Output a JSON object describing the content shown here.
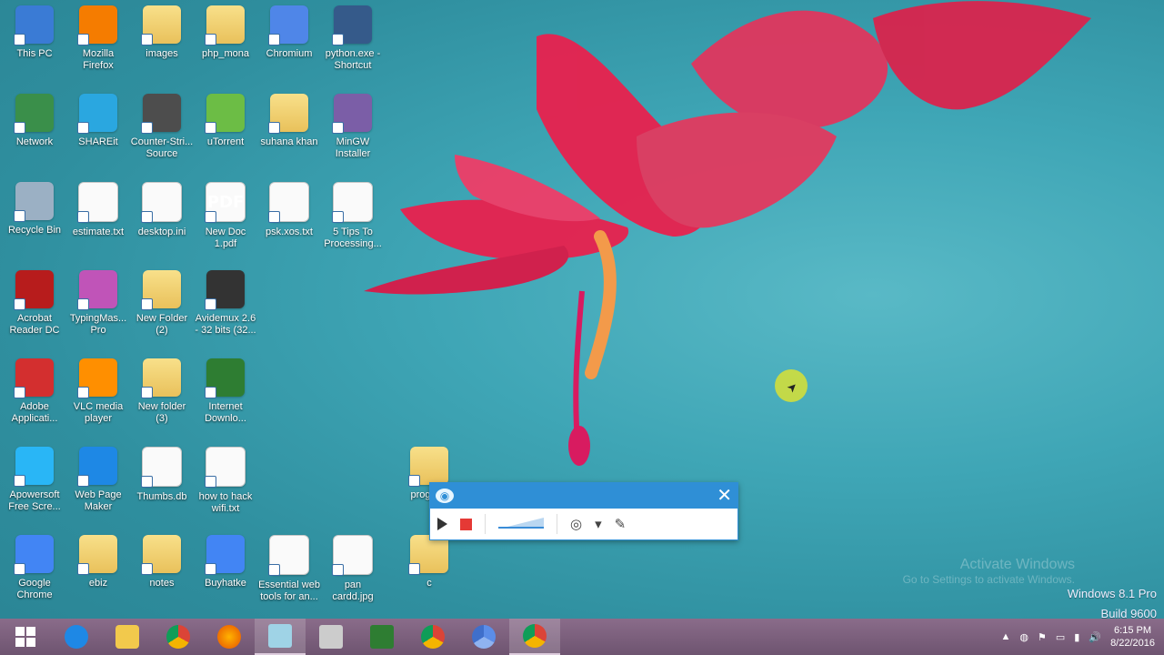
{
  "desktop_icons": [
    {
      "label": "This PC",
      "icon": "computer-icon"
    },
    {
      "label": "Mozilla\nFirefox",
      "icon": "firefox-icon"
    },
    {
      "label": "images",
      "icon": "folder-icon"
    },
    {
      "label": "php_mona",
      "icon": "folder-icon"
    },
    {
      "label": "Chromium",
      "icon": "chromium-icon"
    },
    {
      "label": "python.exe -\nShortcut",
      "icon": "python-icon"
    },
    {
      "label": "Network",
      "icon": "network-icon"
    },
    {
      "label": "SHAREit",
      "icon": "shareit-icon"
    },
    {
      "label": "Counter-Stri...\nSource",
      "icon": "counter-strike-icon"
    },
    {
      "label": "uTorrent",
      "icon": "utorrent-icon"
    },
    {
      "label": "suhana khan",
      "icon": "folder-icon"
    },
    {
      "label": "MinGW\nInstaller",
      "icon": "installer-icon"
    },
    {
      "label": "Recycle Bin",
      "icon": "recycle-bin-icon"
    },
    {
      "label": "estimate.txt",
      "icon": "text-file-icon"
    },
    {
      "label": "desktop.ini",
      "icon": "ini-file-icon"
    },
    {
      "label": "New Doc\n1.pdf",
      "icon": "pdf-file-icon"
    },
    {
      "label": "psk.xos.txt",
      "icon": "text-file-icon"
    },
    {
      "label": "5 Tips To\nProcessing...",
      "icon": "doc-file-icon"
    },
    {
      "label": "Acrobat\nReader DC",
      "icon": "acrobat-icon"
    },
    {
      "label": "TypingMas...\nPro",
      "icon": "typingmaster-icon"
    },
    {
      "label": "New Folder\n(2)",
      "icon": "folder-icon"
    },
    {
      "label": "Avidemux 2.6\n- 32 bits (32...",
      "icon": "avidemux-icon"
    },
    {
      "label": "Adobe\nApplicati...",
      "icon": "adobe-icon"
    },
    {
      "label": "VLC media\nplayer",
      "icon": "vlc-icon"
    },
    {
      "label": "New folder\n(3)",
      "icon": "folder-icon"
    },
    {
      "label": "Internet\nDownlo...",
      "icon": "idm-icon"
    },
    {
      "label": "Apowersoft\nFree Scre...",
      "icon": "apowersoft-icon"
    },
    {
      "label": "Web Page\nMaker",
      "icon": "webpagemaker-icon"
    },
    {
      "label": "Thumbs.db",
      "icon": "db-file-icon"
    },
    {
      "label": "how to hack\nwifi.txt",
      "icon": "text-file-icon"
    },
    {
      "label": "program",
      "icon": "folder-icon"
    },
    {
      "label": "Google\nChrome",
      "icon": "chrome-icon"
    },
    {
      "label": "ebiz",
      "icon": "folder-icon"
    },
    {
      "label": "notes",
      "icon": "folder-icon"
    },
    {
      "label": "Buyhatke",
      "icon": "chrome-icon"
    },
    {
      "label": "Essential web\ntools for an...",
      "icon": "doc-file-icon"
    },
    {
      "label": "pan\ncardd.jpg",
      "icon": "image-file-icon"
    },
    {
      "label": "c",
      "icon": "folder-icon"
    }
  ],
  "recorder": {
    "close_label": "✕"
  },
  "watermark": {
    "line1": "Activate Windows",
    "line2": "Go to Settings to activate Windows."
  },
  "version": {
    "line1": "Windows 8.1 Pro",
    "line2": "Build 9600"
  },
  "taskbar": {
    "items": [
      {
        "name": "start-button",
        "icon": "windows-logo-icon"
      },
      {
        "name": "internet-explorer",
        "icon": "ie-icon"
      },
      {
        "name": "file-explorer",
        "icon": "folder-icon"
      },
      {
        "name": "chrome",
        "icon": "chrome-icon"
      },
      {
        "name": "firefox",
        "icon": "firefox-icon"
      },
      {
        "name": "screen-recorder",
        "icon": "recorder-icon"
      },
      {
        "name": "media-player",
        "icon": "media-icon"
      },
      {
        "name": "store",
        "icon": "store-icon"
      },
      {
        "name": "chrome-2",
        "icon": "chrome-icon"
      },
      {
        "name": "chromium",
        "icon": "chromium-icon"
      },
      {
        "name": "chrome-3",
        "icon": "chrome-icon"
      }
    ],
    "clock": {
      "time": "6:15 PM",
      "date": "8/22/2016"
    }
  }
}
